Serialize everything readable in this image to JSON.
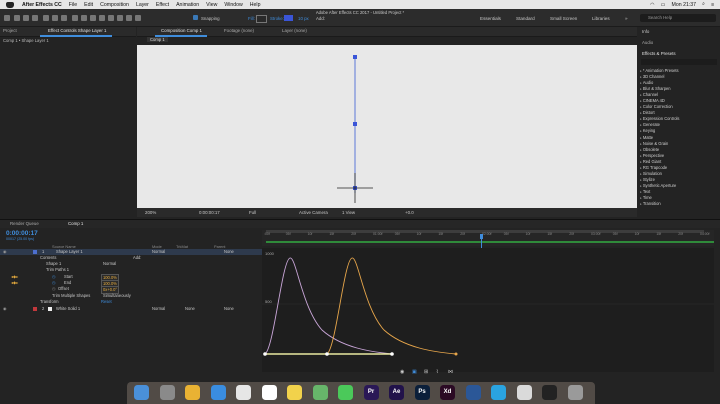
{
  "menubar": {
    "app_name": "After Effects CC",
    "items": [
      "File",
      "Edit",
      "Composition",
      "Layer",
      "Effect",
      "Animation",
      "View",
      "Window",
      "Help"
    ],
    "clock": "Mon 21:37"
  },
  "window_title": "Adobe After Effects CC 2017 - Untitled Project *",
  "toolbar": {
    "snapping_label": "Snapping",
    "fill_label": "Fill:",
    "stroke_label": "Stroke:",
    "stroke_width": "10 px",
    "add_label": "Add:",
    "workspaces": [
      "Essentials",
      "Standard",
      "Small Screen",
      "Libraries"
    ],
    "search_placeholder": "Search Help"
  },
  "left_panel": {
    "tab_project": "Project",
    "tab_effect_controls": "Effect Controls Shape Layer 1",
    "breadcrumb": "Comp 1 • Shape Layer 1"
  },
  "comp_panel": {
    "tab_composition": "Composition Comp 1",
    "tab_footage": "Footage (none)",
    "tab_layer": "Layer (none)",
    "subtab": "Comp 1",
    "zoom": "200%",
    "timecode": "0:00:00:17",
    "resolution": "Full",
    "camera": "Active Camera",
    "views": "1 View",
    "exposure": "+0.0"
  },
  "right_panel": {
    "info_tab": "Info",
    "audio_tab": "Audio",
    "effects_tab": "Effects & Presets",
    "effects": [
      "* Animation Presets",
      "3D Channel",
      "Audio",
      "Blur & Sharpen",
      "Channel",
      "CINEMA 4D",
      "Color Correction",
      "Distort",
      "Expression Controls",
      "Generate",
      "Keying",
      "Matte",
      "Noise & Grain",
      "Obsolete",
      "Perspective",
      "Red Giant",
      "RG Trapcode",
      "Simulation",
      "Stylize",
      "Synthetic Aperture",
      "Text",
      "Time",
      "Transition"
    ]
  },
  "timeline": {
    "tab_render_queue": "Render Queue",
    "tab_comp": "Comp 1",
    "timecode": "0:00:00:17",
    "timecode_sub": "00017 (25.00 fps)",
    "columns": {
      "source_name": "Source Name",
      "mode": "Mode",
      "trkmat": "TrkMat",
      "parent": "Parent"
    },
    "layers": [
      {
        "num": "1",
        "name": "Shape Layer 1",
        "mode": "Normal",
        "parent": "None"
      },
      {
        "num": "2",
        "name": "White Solid 1",
        "mode": "Normal",
        "trkmat": "None",
        "parent": "None"
      }
    ],
    "props": {
      "contents": "Contents",
      "add": "Add:",
      "shape": "Shape 1",
      "shape_mode": "Normal",
      "trim": "Trim Paths 1",
      "start_label": "Start",
      "start_value": "100.0%",
      "end_label": "End",
      "end_value": "100.0%",
      "offset_label": "Offset",
      "offset_value": "0x+0.0°",
      "trim_multi": "Trim Multiple Shapes",
      "trim_multi_value": "Simultaneously",
      "transform": "Transform",
      "reset": "Reset"
    },
    "ruler": [
      ":00f",
      "05f",
      "10f",
      "15f",
      "20f",
      "01:00f",
      "05f",
      "10f",
      "15f",
      "20f",
      "02:00f",
      "05f",
      "10f",
      "15f",
      "20f",
      "03:00f",
      "05f",
      "10f",
      "15f",
      "20f",
      "04:00f"
    ],
    "graph_labels": [
      "1000",
      "500"
    ]
  },
  "dock": [
    "Finder",
    "Launchpad",
    "Chrome",
    "Safari",
    "Photos",
    "Calendar",
    "Notes",
    "Maps",
    "Messages",
    "Pr",
    "Ae",
    "Ps",
    "Xd",
    "Word",
    "Skype",
    "Preview",
    "Terminal",
    "Trash"
  ]
}
